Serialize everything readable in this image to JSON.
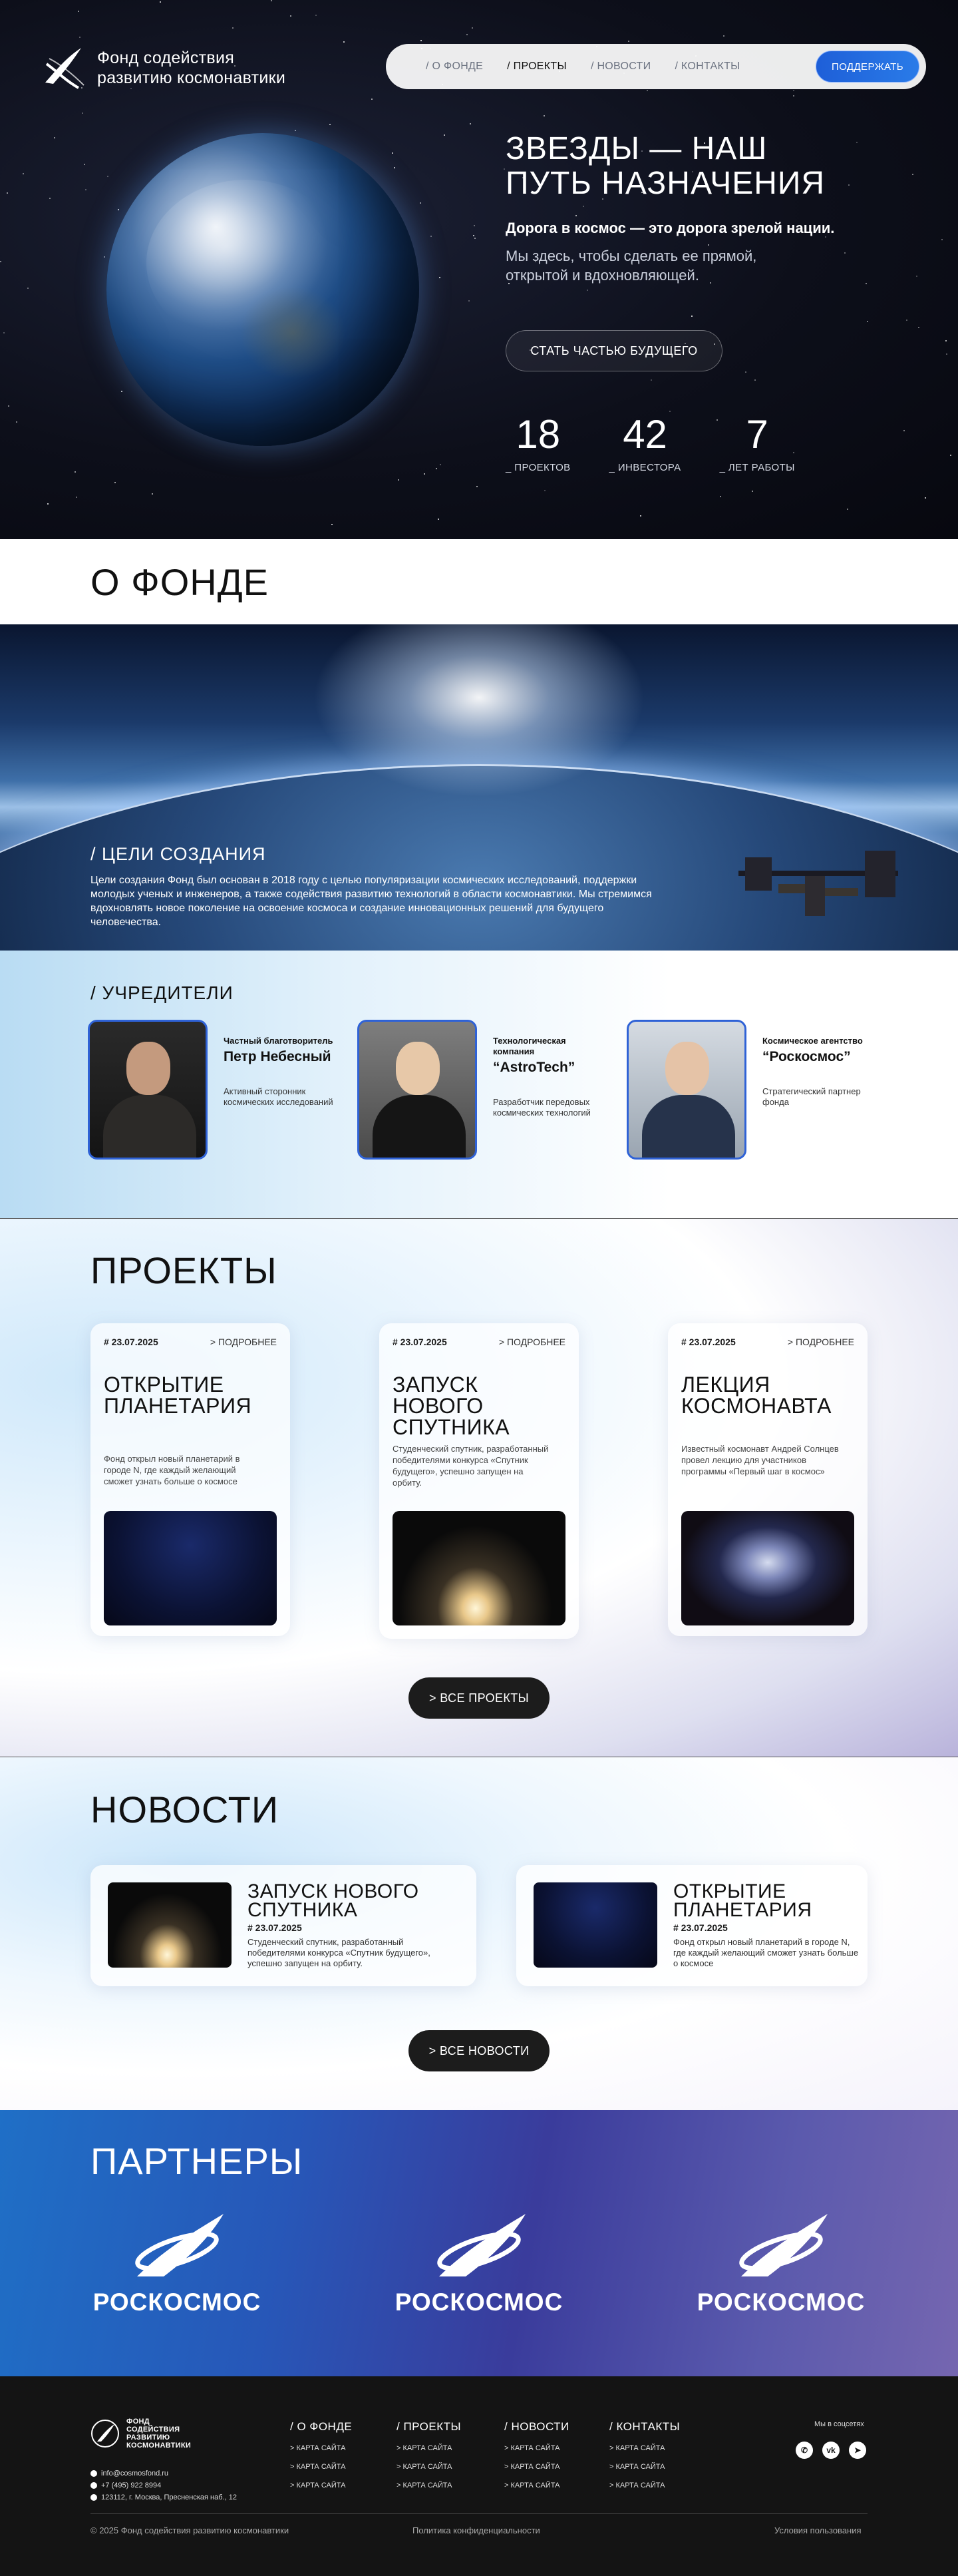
{
  "header": {
    "logo_text_line1": "Фонд содействия",
    "logo_text_line2": "развитию космонавтики",
    "nav": [
      "/ О ФОНДЕ",
      "/ ПРОЕКТЫ",
      "/ НОВОСТИ",
      "/ КОНТАКТЫ"
    ],
    "nav_active": "/ ПРОЕКТЫ",
    "support_button": "ПОДДЕРЖАТЬ"
  },
  "hero": {
    "title_line1": "ЗВЕЗДЫ — НАШ",
    "title_line2": "ПУТЬ НАЗНАЧЕНИЯ",
    "subtitle": "Дорога в космос — это дорога зрелой нации.",
    "text": "Мы здесь, чтобы сделать ее прямой, открытой и вдохновляющей.",
    "cta": "СТАТЬ ЧАСТЬЮ БУДУЩЕГО",
    "stats": [
      {
        "value": "18",
        "label": "_ ПРОЕКТОВ"
      },
      {
        "value": "42",
        "label": "_ ИНВЕСТОРА"
      },
      {
        "value": "7",
        "label": "_ ЛЕТ РАБОТЫ"
      }
    ]
  },
  "about": {
    "title": "О ФОНДЕ",
    "goals_title": "/ ЦЕЛИ СОЗДАНИЯ",
    "goals_text": "Цели создания Фонд был основан в 2018 году с целью популяризации космических исследований, поддержки молодых ученых и инженеров, а также содействия развитию технологий в области космонавтики. Мы стремимся вдохновлять новое поколение на освоение космоса и создание инновационных решений для будущего человечества."
  },
  "founders": {
    "title": "/ УЧРЕДИТЕЛИ",
    "items": [
      {
        "role": "Частный благотворитель",
        "name": "Петр Небесный",
        "desc": "Активный сторонник космических исследований"
      },
      {
        "role": "Технологическая компания",
        "name": "“AstroTech”",
        "desc": "Разработчик передовых космических технологий"
      },
      {
        "role": "Космическое агентство",
        "name": "“Роскосмос”",
        "desc": "Стратегический партнер фонда"
      }
    ]
  },
  "projects": {
    "title": "ПРОЕКТЫ",
    "items": [
      {
        "date": "# 23.07.2025",
        "more": "> ПОДРОБНЕЕ",
        "title": "ОТКРЫТИЕ ПЛАНЕТАРИЯ",
        "text": "Фонд открыл новый планетарий в городе N, где каждый желающий сможет узнать больше о космосе"
      },
      {
        "date": "# 23.07.2025",
        "more": "> ПОДРОБНЕЕ",
        "title": "ЗАПУСК НОВОГО СПУТНИКА",
        "text": "Студенческий спутник, разработанный победителями конкурса «Спутник будущего», успешно запущен на орбиту."
      },
      {
        "date": "# 23.07.2025",
        "more": "> ПОДРОБНЕЕ",
        "title": "ЛЕКЦИЯ КОСМОНАВТА",
        "text": "Известный космонавт Андрей Солнцев провел лекцию для участников программы «Первый шаг в космос»"
      }
    ],
    "all_button": "> ВСЕ ПРОЕКТЫ"
  },
  "news": {
    "title": "НОВОСТИ",
    "items": [
      {
        "title": "ЗАПУСК НОВОГО СПУТНИКА",
        "date": "# 23.07.2025",
        "text": "Студенческий спутник, разработанный победителями конкурса «Спутник будущего», успешно запущен на орбиту."
      },
      {
        "title": "ОТКРЫТИЕ ПЛАНЕТАРИЯ",
        "date": "# 23.07.2025",
        "text": "Фонд открыл новый планетарий в городе N, где каждый желающий сможет узнать больше о космосе"
      }
    ],
    "all_button": "> ВСЕ НОВОСТИ"
  },
  "partners": {
    "title": "ПАРТНЕРЫ",
    "items": [
      "РОСКОСМОС",
      "РОСКОСМОС",
      "РОСКОСМОС"
    ]
  },
  "footer": {
    "logo_text": [
      "ФОНД",
      "СОДЕЙСТВИЯ",
      "РАЗВИТИЮ",
      "КОСМОНАВТИКИ"
    ],
    "email": "info@cosmosfond.ru",
    "phone": "+7 (495) 922 8994",
    "address": "123112, г. Москва, Пресненская наб., 12",
    "columns": [
      {
        "title": "/ О ФОНДЕ",
        "links": [
          "> КАРТА САЙТА",
          "> КАРТА САЙТА",
          "> КАРТА САЙТА"
        ]
      },
      {
        "title": "/ ПРОЕКТЫ",
        "links": [
          "> КАРТА САЙТА",
          "> КАРТА САЙТА",
          "> КАРТА САЙТА"
        ]
      },
      {
        "title": "/ НОВОСТИ",
        "links": [
          "> КАРТА САЙТА",
          "> КАРТА САЙТА",
          "> КАРТА САЙТА"
        ]
      },
      {
        "title": "/ КОНТАКТЫ",
        "links": [
          "> КАРТА САЙТА",
          "> КАРТА САЙТА",
          "> КАРТА САЙТА"
        ]
      }
    ],
    "social_title": "Мы в соцсетях",
    "social": [
      "whatsapp-icon",
      "vk-icon",
      "telegram-icon"
    ],
    "copyright": "© 2025 Фонд содействия развитию космонавтики",
    "privacy": "Политика конфиденциальности",
    "terms": "Условия пользования"
  },
  "colors": {
    "accent": "#2a6be0",
    "dark": "#141414",
    "hero_bg": "#0d0f1a"
  }
}
